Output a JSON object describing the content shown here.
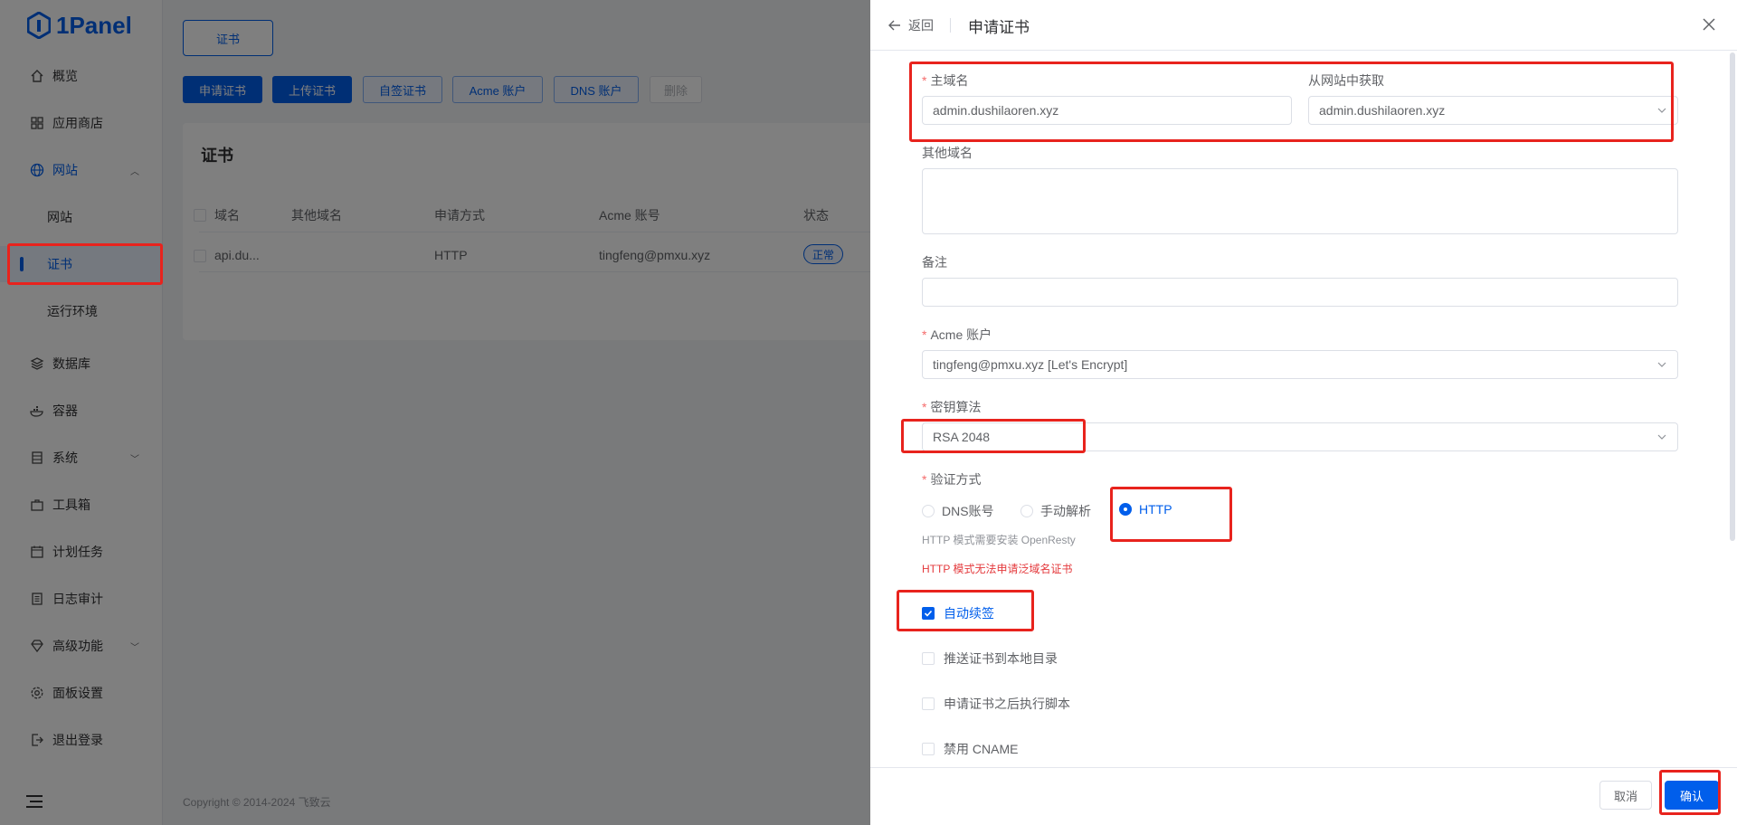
{
  "app": {
    "name": "1Panel"
  },
  "sidebar": {
    "items": [
      {
        "label": "概览",
        "icon": "home-icon"
      },
      {
        "label": "应用商店",
        "icon": "apps-grid-icon"
      },
      {
        "label": "网站",
        "icon": "globe-icon"
      },
      {
        "label": "网站",
        "icon": ""
      },
      {
        "label": "证书",
        "icon": ""
      },
      {
        "label": "运行环境",
        "icon": ""
      },
      {
        "label": "数据库",
        "icon": "layers-icon"
      },
      {
        "label": "容器",
        "icon": "docker-icon"
      },
      {
        "label": "系统",
        "icon": "server-icon"
      },
      {
        "label": "工具箱",
        "icon": "toolbox-icon"
      },
      {
        "label": "计划任务",
        "icon": "calendar-icon"
      },
      {
        "label": "日志审计",
        "icon": "log-icon"
      },
      {
        "label": "高级功能",
        "icon": "diamond-icon"
      },
      {
        "label": "面板设置",
        "icon": "gear-icon"
      },
      {
        "label": "退出登录",
        "icon": "logout-icon"
      }
    ]
  },
  "main": {
    "tab": "证书",
    "buttons": [
      "申请证书",
      "上传证书",
      "自签证书",
      "Acme 账户",
      "DNS 账户",
      "删除"
    ],
    "card_title": "证书",
    "table": {
      "headers": [
        "域名",
        "其他域名",
        "申请方式",
        "Acme 账号",
        "状态"
      ],
      "rows": [
        {
          "domain": "api.du...",
          "other": "",
          "method": "HTTP",
          "acme": "tingfeng@pmxu.xyz",
          "status": "正常"
        }
      ]
    },
    "footer": "Copyright © 2014-2024 飞致云"
  },
  "drawer": {
    "back": "返回",
    "title": "申请证书",
    "primary_domain_label": "主域名",
    "primary_domain_value": "admin.dushilaoren.xyz",
    "from_site_label": "从网站中获取",
    "from_site_value": "admin.dushilaoren.xyz",
    "other_domains_label": "其他域名",
    "remark_label": "备注",
    "acme_label": "Acme 账户",
    "acme_value": "tingfeng@pmxu.xyz [Let's Encrypt]",
    "key_label": "密钥算法",
    "key_value": "RSA 2048",
    "verify_label": "验证方式",
    "verify_options": [
      "DNS账号",
      "手动解析",
      "HTTP"
    ],
    "verify_selected": "HTTP",
    "hint1": "HTTP 模式需要安装 OpenResty",
    "hint2": "HTTP 模式无法申请泛域名证书",
    "checks": [
      {
        "label": "自动续签",
        "checked": true
      },
      {
        "label": "推送证书到本地目录",
        "checked": false
      },
      {
        "label": "申请证书之后执行脚本",
        "checked": false
      },
      {
        "label": "禁用 CNAME",
        "checked": false
      }
    ],
    "cancel": "取消",
    "confirm": "确认"
  },
  "colors": {
    "primary": "#005eeb",
    "annotation": "#e8231d",
    "error": "#e4393c"
  }
}
